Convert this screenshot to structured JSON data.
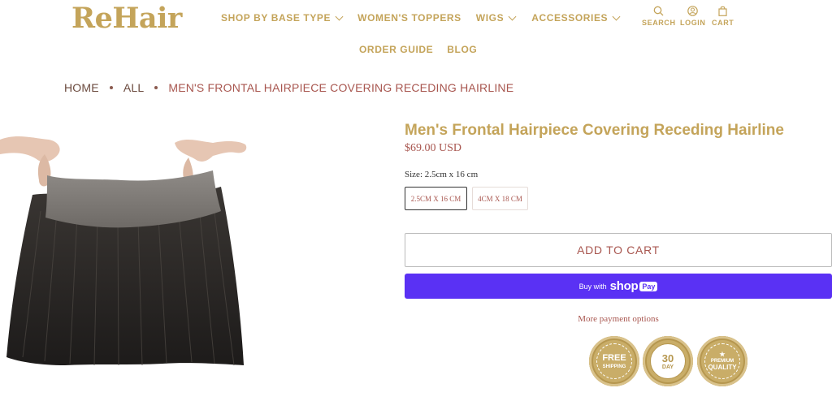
{
  "header": {
    "logo": "ReHair",
    "nav_row1": [
      {
        "label": "SHOP BY BASE TYPE",
        "has_dropdown": true
      },
      {
        "label": "WOMEN'S TOPPERS",
        "has_dropdown": false
      },
      {
        "label": "WIGS",
        "has_dropdown": true
      },
      {
        "label": "ACCESSORIES",
        "has_dropdown": true
      }
    ],
    "nav_row2": [
      {
        "label": "ORDER GUIDE"
      },
      {
        "label": "BLOG"
      }
    ],
    "utilities": {
      "search": "SEARCH",
      "login": "LOGIN",
      "cart": "CART"
    }
  },
  "breadcrumb": [
    "HOME",
    "ALL",
    "MEN'S FRONTAL HAIRPIECE COVERING RECEDING HAIRLINE"
  ],
  "product": {
    "title": "Men's Frontal Hairpiece Covering Receding Hairline",
    "price": "$69.00 USD",
    "size_label": "Size: 2.5cm x 16 cm",
    "variants": [
      {
        "label": "2.5CM X 16 CM",
        "selected": true
      },
      {
        "label": "4CM X 18 CM",
        "selected": false
      }
    ],
    "add_to_cart": "ADD TO CART",
    "shop_pay": {
      "prefix": "Buy with",
      "brand": "shop",
      "pay": "Pay"
    },
    "more_payment": "More payment options"
  },
  "badges": [
    {
      "name": "free-shipping",
      "lines": [
        "FREE",
        "SHIPPING"
      ]
    },
    {
      "name": "money-back",
      "lines": [
        "30",
        "DAY"
      ],
      "ring": "100% MONEY BACK GUARANTEE"
    },
    {
      "name": "premium-quality",
      "lines": [
        "★",
        "PREMIUM",
        "QUALITY"
      ]
    }
  ],
  "colors": {
    "gold": "#c4a45a",
    "rust": "#a8564f",
    "shop_pay": "#5a31f4"
  }
}
